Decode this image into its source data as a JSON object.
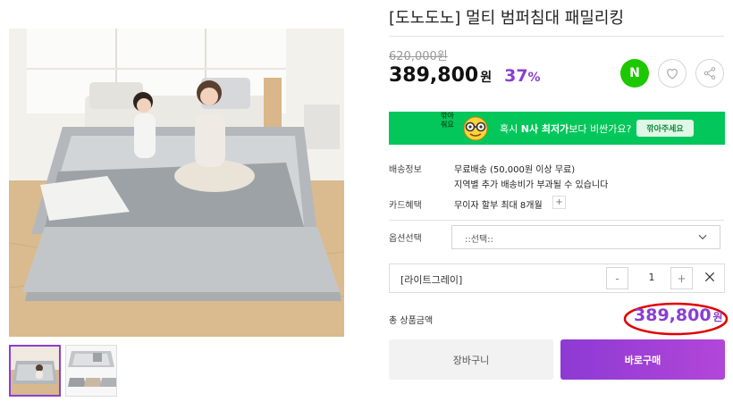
{
  "product": {
    "title": "[도노도노] 멀티 범퍼침대 패밀리킹",
    "original_price": "620,000원",
    "sale_price": "389,800",
    "sale_price_unit": "원",
    "discount_rate": "37",
    "discount_unit": "%"
  },
  "actions": {
    "naver_badge": "N",
    "wishlist_icon": "heart-icon",
    "share_icon": "share-icon"
  },
  "banner": {
    "logo_line1": "깎아",
    "logo_line2": "줘요",
    "text_prefix": "혹시 ",
    "text_bold": "N사 최저가",
    "text_suffix": "보다 비싼가요?",
    "button_label": "깎아주세요"
  },
  "info": {
    "shipping_label": "배송정보",
    "shipping_value_1": "무료배송 (50,000원 이상 무료)",
    "shipping_value_2": "지역별 추가 배송비가 부과될 수 있습니다",
    "card_label": "카드혜택",
    "card_value": "무이자 할부 최대 8개월",
    "card_more": "+"
  },
  "option": {
    "label": "옵션선택",
    "placeholder": "::선택::"
  },
  "selected_option": {
    "name": "[라이트그레이]",
    "minus": "-",
    "quantity": "1",
    "plus": "+"
  },
  "total": {
    "label": "총 상품금액",
    "amount": "389,800",
    "unit": "원"
  },
  "buttons": {
    "cart": "장바구니",
    "buy": "바로구매"
  },
  "colors": {
    "accent": "#8a3fd1",
    "naver_green": "#1ec800",
    "banner_green": "#03c75a",
    "annotation_red": "#e00000"
  }
}
